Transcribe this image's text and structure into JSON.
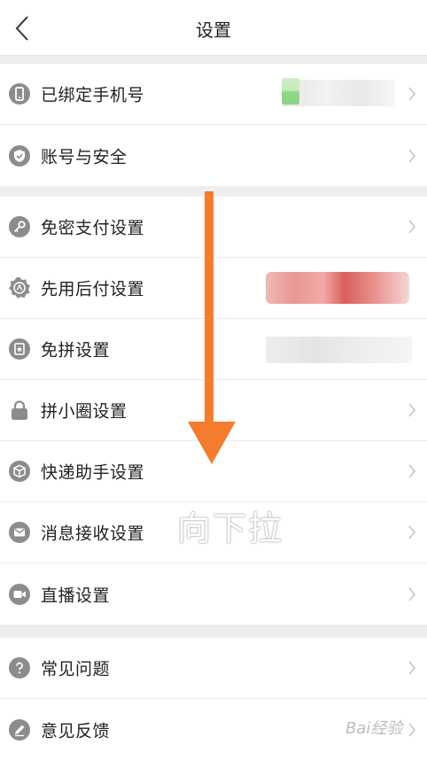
{
  "header": {
    "title": "设置"
  },
  "groups": [
    {
      "items": [
        {
          "label": "已绑定手机号",
          "icon": "phone-icon"
        },
        {
          "label": "账号与安全",
          "icon": "shield-check-icon"
        }
      ]
    },
    {
      "items": [
        {
          "label": "免密支付设置",
          "icon": "key-icon"
        },
        {
          "label": "先用后付设置",
          "icon": "badge-icon"
        },
        {
          "label": "免拼设置",
          "icon": "star-box-icon"
        },
        {
          "label": "拼小圈设置",
          "icon": "lock-icon"
        },
        {
          "label": "快递助手设置",
          "icon": "package-icon"
        },
        {
          "label": "消息接收设置",
          "icon": "mail-icon"
        },
        {
          "label": "直播设置",
          "icon": "video-camera-icon"
        }
      ]
    },
    {
      "items": [
        {
          "label": "常见问题",
          "icon": "question-icon"
        },
        {
          "label": "意见反馈",
          "icon": "edit-icon"
        }
      ]
    }
  ],
  "overlay": {
    "hint": "向下拉"
  },
  "watermark": "Bai经验",
  "colors": {
    "arrow": "#f47c2c",
    "icon_gray": "#8c8c8c",
    "chevron": "#c4c4c4"
  }
}
